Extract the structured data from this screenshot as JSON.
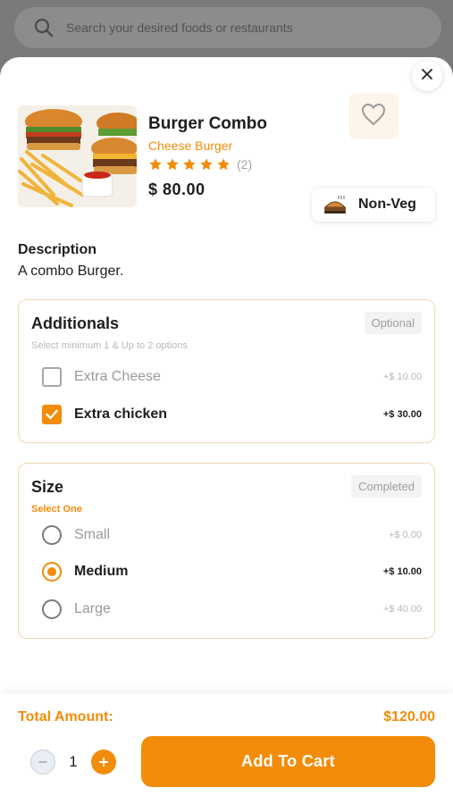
{
  "background": {
    "search_placeholder": "Search your desired foods or restaurants"
  },
  "product": {
    "name": "Burger Combo",
    "category": "Cheese Burger",
    "rating_stars": 5,
    "rating_count": "(2)",
    "price": "$ 80.00",
    "diet_badge": "Non-Veg",
    "image_icon": "burger-combo-image",
    "favorite_icon": "heart-outline-icon"
  },
  "description": {
    "label": "Description",
    "text": "A combo Burger."
  },
  "additionals": {
    "title": "Additionals",
    "tag": "Optional",
    "hint": "Select minimum 1 & Up to 2 options",
    "options": [
      {
        "label": "Extra Cheese",
        "price": "+$ 10.00",
        "checked": false
      },
      {
        "label": "Extra chicken",
        "price": "+$ 30.00",
        "checked": true
      }
    ]
  },
  "size": {
    "title": "Size",
    "tag": "Completed",
    "hint": "Select One",
    "options": [
      {
        "label": "Small",
        "price": "+$ 0.00",
        "selected": false
      },
      {
        "label": "Medium",
        "price": "+$ 10.00",
        "selected": true
      },
      {
        "label": "Large",
        "price": "+$ 40.00",
        "selected": false
      }
    ]
  },
  "footer": {
    "total_label": "Total Amount:",
    "total_value": "$120.00",
    "quantity": "1",
    "add_to_cart_label": "Add To Cart"
  },
  "colors": {
    "accent": "#f28c0a",
    "text": "#1e1e1e",
    "muted": "#9a9a9a"
  }
}
